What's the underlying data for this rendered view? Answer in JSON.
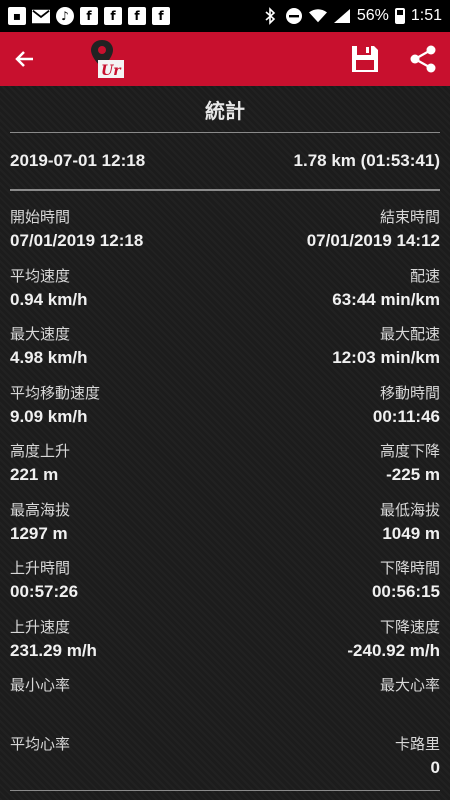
{
  "status_bar": {
    "battery": "56%",
    "time": "1:51",
    "battery_level": 0.56
  },
  "header": {
    "logo_text": "Ur"
  },
  "page": {
    "title": "統計"
  },
  "summary": {
    "date": "2019-07-01 12:18",
    "distance": "1.78 km (01:53:41)"
  },
  "stats": [
    {
      "left_label": "開始時間",
      "left_value": "07/01/2019 12:18",
      "right_label": "結束時間",
      "right_value": "07/01/2019 14:12"
    },
    {
      "left_label": "平均速度",
      "left_value": "0.94 km/h",
      "right_label": "配速",
      "right_value": "63:44 min/km"
    },
    {
      "left_label": "最大速度",
      "left_value": "4.98 km/h",
      "right_label": "最大配速",
      "right_value": "12:03 min/km"
    },
    {
      "left_label": "平均移動速度",
      "left_value": "9.09 km/h",
      "right_label": "移動時間",
      "right_value": "00:11:46"
    },
    {
      "left_label": "高度上升",
      "left_value": "221 m",
      "right_label": "高度下降",
      "right_value": "-225 m"
    },
    {
      "left_label": "最高海拔",
      "left_value": "1297 m",
      "right_label": "最低海拔",
      "right_value": "1049 m"
    },
    {
      "left_label": "上升時間",
      "left_value": "00:57:26",
      "right_label": "下降時間",
      "right_value": "00:56:15"
    },
    {
      "left_label": "上升速度",
      "left_value": "231.29 m/h",
      "right_label": "下降速度",
      "right_value": "-240.92 m/h"
    },
    {
      "left_label": "最小心率",
      "left_value": "",
      "right_label": "最大心率",
      "right_value": ""
    },
    {
      "left_label": "平均心率",
      "left_value": "",
      "right_label": "卡路里",
      "right_value": "0"
    }
  ],
  "colors": {
    "app_bar": "#c8102e",
    "background": "#1c1c1c",
    "status_bar": "#000000"
  }
}
